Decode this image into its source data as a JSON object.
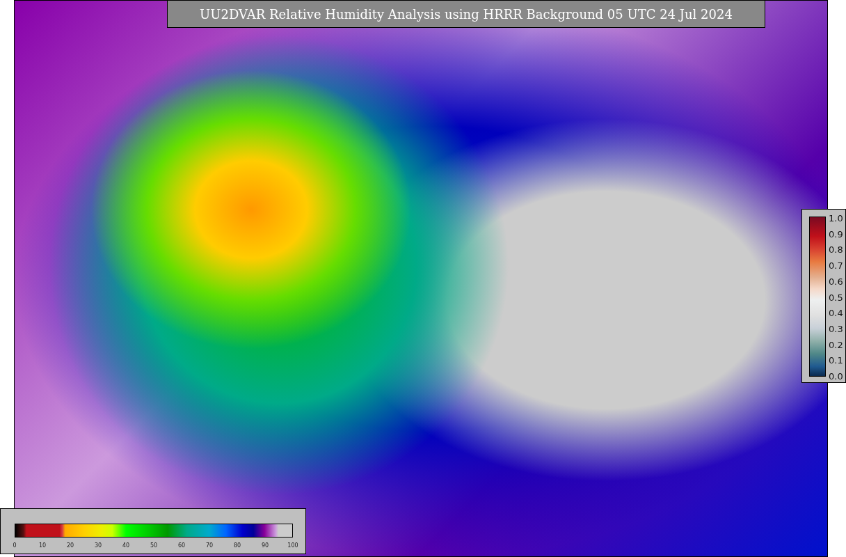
{
  "title": "UU2DVAR Relative Humidity Analysis using HRRR Background 05 UTC 24 Jul 2024",
  "humidity_colorbar": {
    "ticks": [
      "0",
      "10",
      "20",
      "30",
      "40",
      "50",
      "60",
      "70",
      "80",
      "90",
      "100"
    ]
  },
  "observation_colorbar": {
    "ticks": [
      "1.0",
      "0.9",
      "0.8",
      "0.7",
      "0.6",
      "0.5",
      "0.4",
      "0.3",
      "0.2",
      "0.1",
      "0.0"
    ]
  }
}
